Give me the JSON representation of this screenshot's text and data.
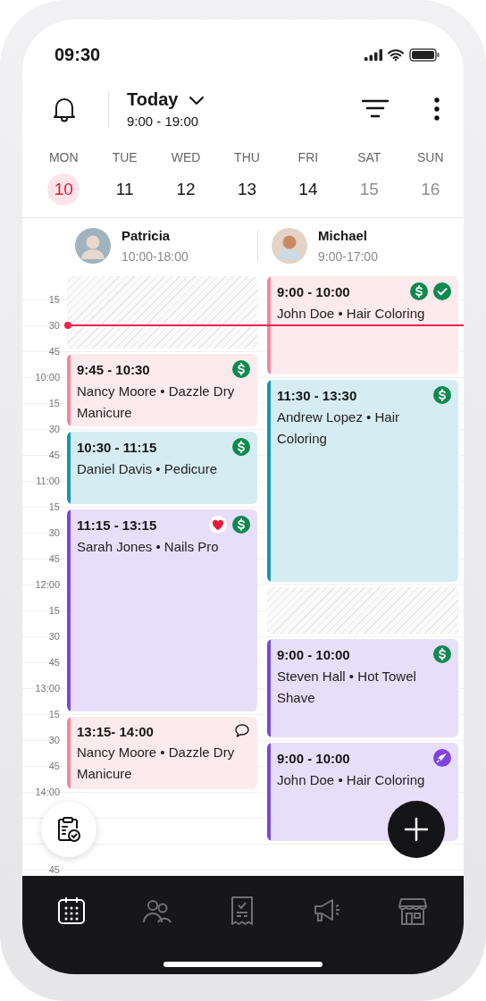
{
  "status_bar": {
    "time": "09:30"
  },
  "header": {
    "title": "Today",
    "hours": "9:00 - 19:00"
  },
  "week": [
    {
      "day": "MON",
      "date": "10",
      "selected": true,
      "weekend": false
    },
    {
      "day": "TUE",
      "date": "11",
      "selected": false,
      "weekend": false
    },
    {
      "day": "WED",
      "date": "12",
      "selected": false,
      "weekend": false
    },
    {
      "day": "THU",
      "date": "13",
      "selected": false,
      "weekend": false
    },
    {
      "day": "FRI",
      "date": "14",
      "selected": false,
      "weekend": false
    },
    {
      "day": "SAT",
      "date": "15",
      "selected": false,
      "weekend": true
    },
    {
      "day": "SUN",
      "date": "16",
      "selected": false,
      "weekend": true
    }
  ],
  "time_labels": [
    "15",
    "30",
    "45",
    "10:00",
    "15",
    "30",
    "45",
    "11:00",
    "15",
    "30",
    "45",
    "12:00",
    "15",
    "30",
    "45",
    "13:00",
    "15",
    "30",
    "45",
    "14:00",
    "45"
  ],
  "staff": [
    {
      "name": "Patricia",
      "hours": "10:00-18:00",
      "events": [
        {
          "time": "9:45 - 10:30",
          "details": "Nancy Moore • Dazzle Dry Manicure",
          "color": "#f2899b",
          "badges": [
            {
              "kind": "paid"
            }
          ]
        },
        {
          "time": "10:30 - 11:15",
          "details": "Daniel Davis • Pedicure",
          "color": "#1496b4",
          "badges": [
            {
              "kind": "paid"
            }
          ]
        },
        {
          "time": "11:15 - 13:15",
          "details": "Sarah Jones • Nails Pro",
          "color": "#7c45e0",
          "badges": [
            {
              "kind": "favorite"
            },
            {
              "kind": "paid"
            }
          ]
        },
        {
          "time": "13:15- 14:00",
          "details": "Nancy Moore • Dazzle Dry Manicure",
          "color": "#f2899b",
          "badges": [
            {
              "kind": "note"
            }
          ]
        }
      ]
    },
    {
      "name": "Michael",
      "hours": "9:00-17:00",
      "events": [
        {
          "time": "9:00 - 10:00",
          "details": "John Doe • Hair Coloring",
          "color": "#f2899b",
          "badges": [
            {
              "kind": "paid"
            },
            {
              "kind": "confirmed"
            }
          ]
        },
        {
          "time": "11:30 - 13:30",
          "details": "Andrew Lopez • Hair Coloring",
          "color": "#1496b4",
          "badges": [
            {
              "kind": "paid"
            }
          ]
        },
        {
          "time": "9:00 - 10:00",
          "details": "Steven Hall • Hot Towel Shave",
          "color": "#7c45e0",
          "badges": [
            {
              "kind": "paid"
            }
          ]
        },
        {
          "time": "9:00 - 10:00",
          "details": "John Doe • Hair Coloring",
          "color": "#7c45e0",
          "badges": [
            {
              "kind": "promoted"
            }
          ]
        }
      ]
    }
  ],
  "nav": [
    {
      "selected": true
    },
    {
      "selected": false
    },
    {
      "selected": false
    },
    {
      "selected": false
    },
    {
      "selected": false
    }
  ]
}
